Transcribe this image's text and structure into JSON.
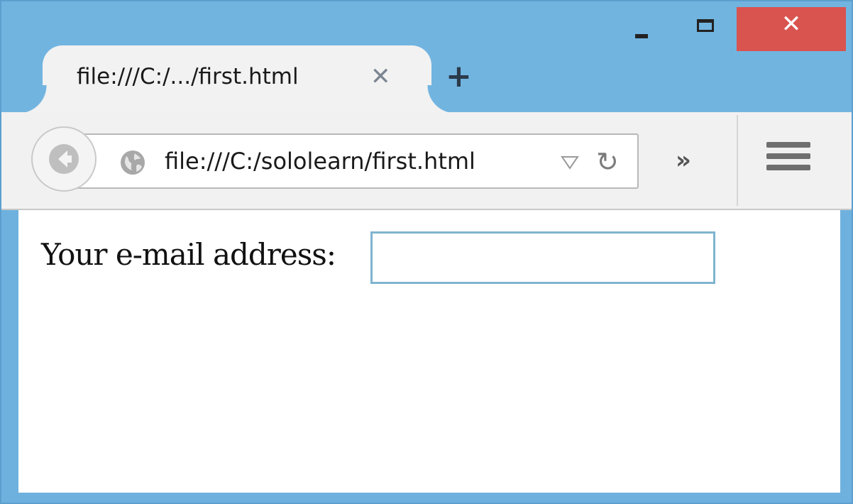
{
  "window": {
    "tab": {
      "title": "file:///C:/.../first.html",
      "close_glyph": "✕"
    },
    "new_tab_glyph": "+",
    "controls": {
      "minimize_icon": "minimize-icon",
      "maximize_icon": "maximize-icon",
      "close_glyph": "✕"
    }
  },
  "navbar": {
    "url": "file:///C:/sololearn/first.html",
    "reload_glyph": "↻",
    "overflow_glyph": "»",
    "icons": {
      "back": "back-arrow-icon",
      "site": "globe-icon",
      "dropdown": "dropmarker-icon",
      "menu": "hamburger-menu-icon"
    }
  },
  "page": {
    "email_label": "Your e-mail address:",
    "email_value": ""
  },
  "colors": {
    "titlebar": "#72b4e0",
    "close_button": "#d9534f",
    "input_border": "#7fb4cf"
  }
}
